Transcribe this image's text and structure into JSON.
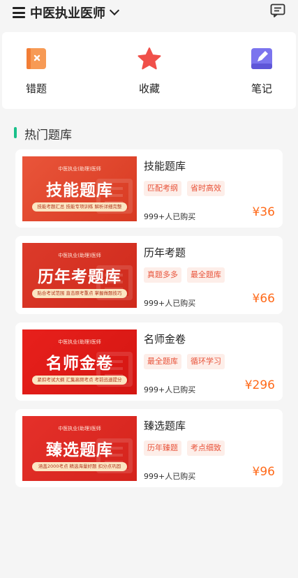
{
  "header": {
    "title": "中医执业医师",
    "menu_icon": "menu-icon",
    "dropdown_icon": "chevron-down-icon",
    "message_icon": "message-icon"
  },
  "quick_nav": [
    {
      "label": "错题",
      "icon": "wrong-questions-icon",
      "color": "#f4823e"
    },
    {
      "label": "收藏",
      "icon": "star-icon",
      "color": "#f0504a"
    },
    {
      "label": "笔记",
      "icon": "note-icon",
      "color": "#6b63e6"
    }
  ],
  "section": {
    "title": "热门题库",
    "accent": "#19c08a"
  },
  "products": [
    {
      "banner_sub": "中医执业(助理)医师",
      "banner_title": "技能题库",
      "banner_pill": "技能考题汇总 技能专项训练 解析详细完整",
      "name": "技能题库",
      "tags": [
        "匹配考纲",
        "省时高效"
      ],
      "bought": "999+人已购买",
      "price": "¥36"
    },
    {
      "banner_sub": "中医执业(助理)医师",
      "banner_title": "历年考题库",
      "banner_pill": "贴合考试范围 直击原考重点 掌握做题技巧",
      "name": "历年考题",
      "tags": [
        "真题多多",
        "最全题库"
      ],
      "bought": "999+人已购买",
      "price": "¥66"
    },
    {
      "banner_sub": "中医执业(助理)医师",
      "banner_title": "名师金卷",
      "banner_pill": "紧扣考试大纲 汇集高频考点 考前迅速提分",
      "name": "名师金卷",
      "tags": [
        "最全题库",
        "循环学习"
      ],
      "bought": "999+人已购买",
      "price": "¥296"
    },
    {
      "banner_sub": "中医执业(助理)医师",
      "banner_title": "臻选题库",
      "banner_pill": "涵盖2000考点 精选海量好题 扣分点巩固",
      "name": "臻选题库",
      "tags": [
        "历年臻题",
        "考点细致"
      ],
      "bought": "999+人已购买",
      "price": "¥96"
    }
  ],
  "colors": {
    "price": "#ff6a1a",
    "tag_text": "#e8533a",
    "tag_bg": "#fdeee9",
    "banner_red": "#e0341f"
  }
}
